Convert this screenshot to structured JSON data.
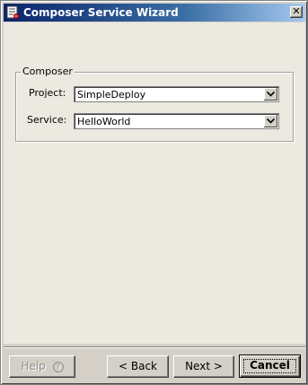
{
  "window": {
    "title": "Composer Service Wizard",
    "close_glyph": "✕"
  },
  "group": {
    "legend": "Composer"
  },
  "fields": {
    "project": {
      "label": "Project:",
      "value": "SimpleDeploy"
    },
    "service": {
      "label": "Service:",
      "value": "HelloWorld"
    }
  },
  "buttons": {
    "help": "Help",
    "help_icon": "?",
    "back": "< Back",
    "next": "Next >",
    "cancel": "Cancel"
  },
  "icons": {
    "app": "wizard-app-icon",
    "dropdown": "chevron-down-icon",
    "help": "help-icon",
    "close": "close-icon"
  }
}
